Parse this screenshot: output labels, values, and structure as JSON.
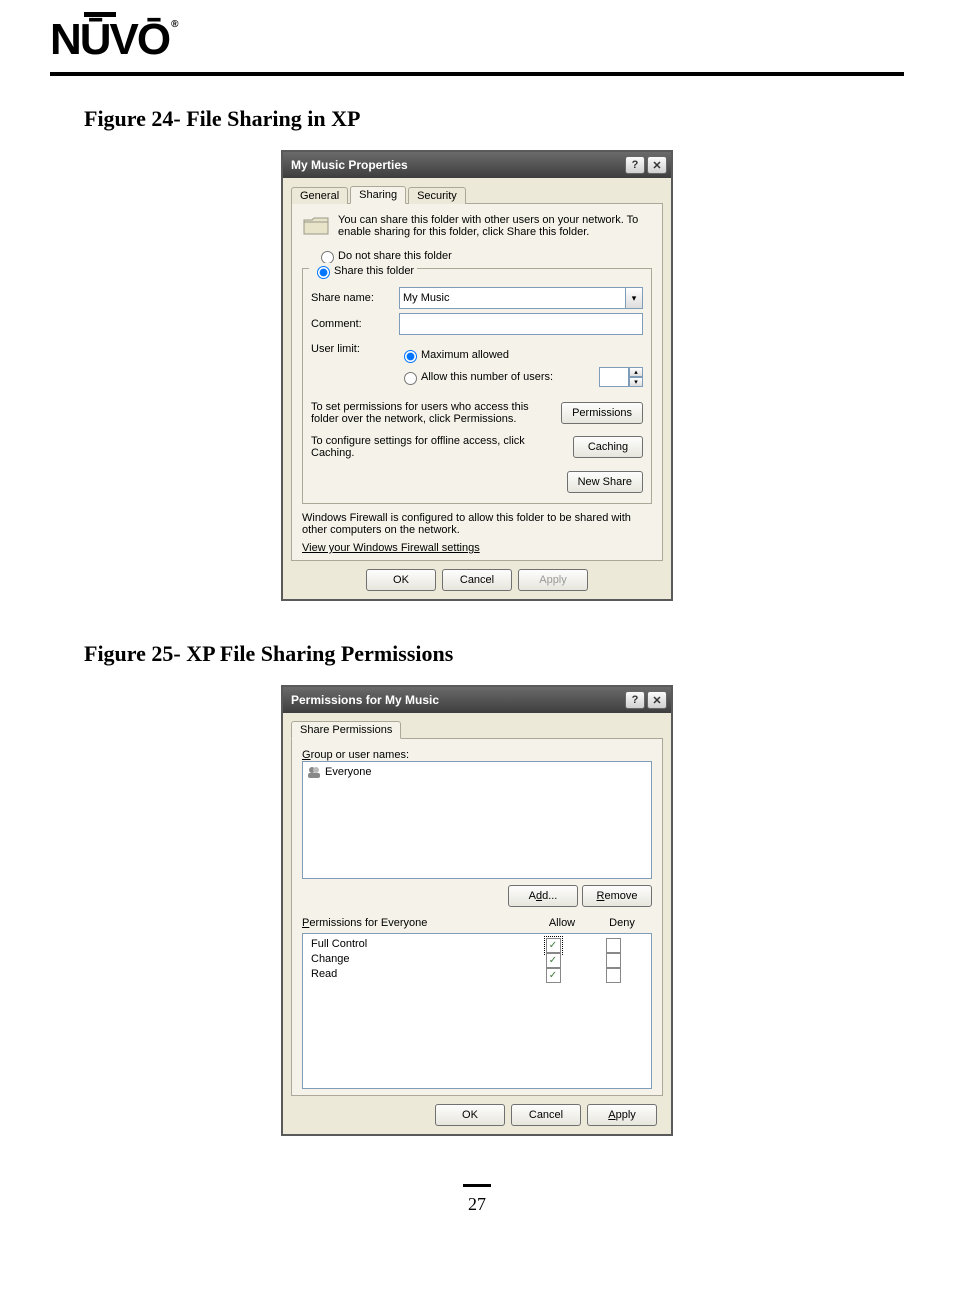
{
  "brand": "NŪVŌ",
  "brand_reg": "®",
  "figure24_caption": "Figure 24- File Sharing in XP",
  "figure25_caption": "Figure 25- XP File Sharing Permissions",
  "page_number": "27",
  "dlg1": {
    "title": "My Music Properties",
    "tabs": {
      "general": "General",
      "sharing": "Sharing",
      "security": "Security"
    },
    "desc": "You can share this folder with other users on your network.  To enable sharing for this folder, click Share this folder.",
    "radio_no_share": "Do not share this folder",
    "radio_share": "Share this folder",
    "share_name_label": "Share name:",
    "share_name_value": "My Music",
    "comment_label": "Comment:",
    "comment_value": "",
    "user_limit_label": "User limit:",
    "max_allowed": "Maximum allowed",
    "allow_num": "Allow this number of users:",
    "perm_text": "To set permissions for users who access this folder over the network, click Permissions.",
    "perm_btn": "Permissions",
    "cache_text": "To configure settings for offline access, click Caching.",
    "cache_btn": "Caching",
    "new_share_btn": "New Share",
    "firewall_text": "Windows Firewall is configured to allow this folder to be shared with other computers on the network.",
    "firewall_link": "View your Windows Firewall settings",
    "ok": "OK",
    "cancel": "Cancel",
    "apply": "Apply"
  },
  "dlg2": {
    "title": "Permissions for My Music",
    "tab": "Share Permissions",
    "group_label_pre": "G",
    "group_label_rest": "roup or user names:",
    "everyone": "Everyone",
    "add_pre": "A",
    "add_mid": "d",
    "add_post": "d...",
    "remove_pre": "R",
    "remove_rest": "emove",
    "perms_for_pre": "P",
    "perms_for_rest": "ermissions for Everyone",
    "col_allow": "Allow",
    "col_deny": "Deny",
    "rows": {
      "full": "Full Control",
      "change": "Change",
      "read": "Read"
    },
    "ok": "OK",
    "cancel": "Cancel",
    "apply_pre": "A",
    "apply_rest": "pply"
  }
}
